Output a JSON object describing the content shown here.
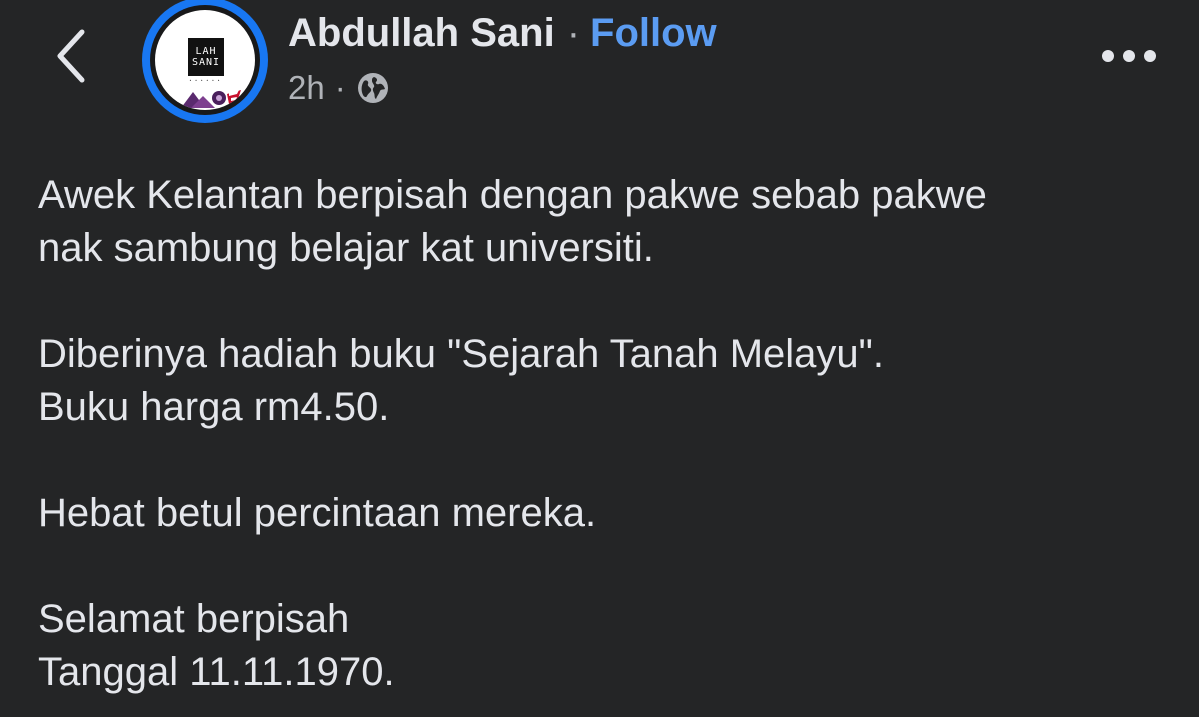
{
  "header": {
    "back_icon": "chevron-left-icon",
    "avatar": {
      "logo_lines": [
        "LAH",
        "SANI"
      ],
      "ring_color": "#1877f2"
    },
    "author": "Abdullah Sani",
    "separator": "·",
    "follow_label": "Follow",
    "time": "2h",
    "meta_separator": "·",
    "audience_icon": "globe-icon",
    "more_icon": "more-horizontal-icon"
  },
  "post": {
    "paragraphs": [
      "Awek Kelantan berpisah dengan pakwe sebab pakwe\nnak sambung belajar kat universiti.",
      "Diberinya hadiah buku \"Sejarah Tanah Melayu\".\nBuku harga rm4.50.",
      "Hebat betul percintaan mereka.",
      "Selamat berpisah\nTanggal 11.11.1970."
    ]
  },
  "colors": {
    "background": "#242526",
    "text": "#e4e6eb",
    "secondary_text": "#b0b3b8",
    "link": "#5b9cf2"
  }
}
